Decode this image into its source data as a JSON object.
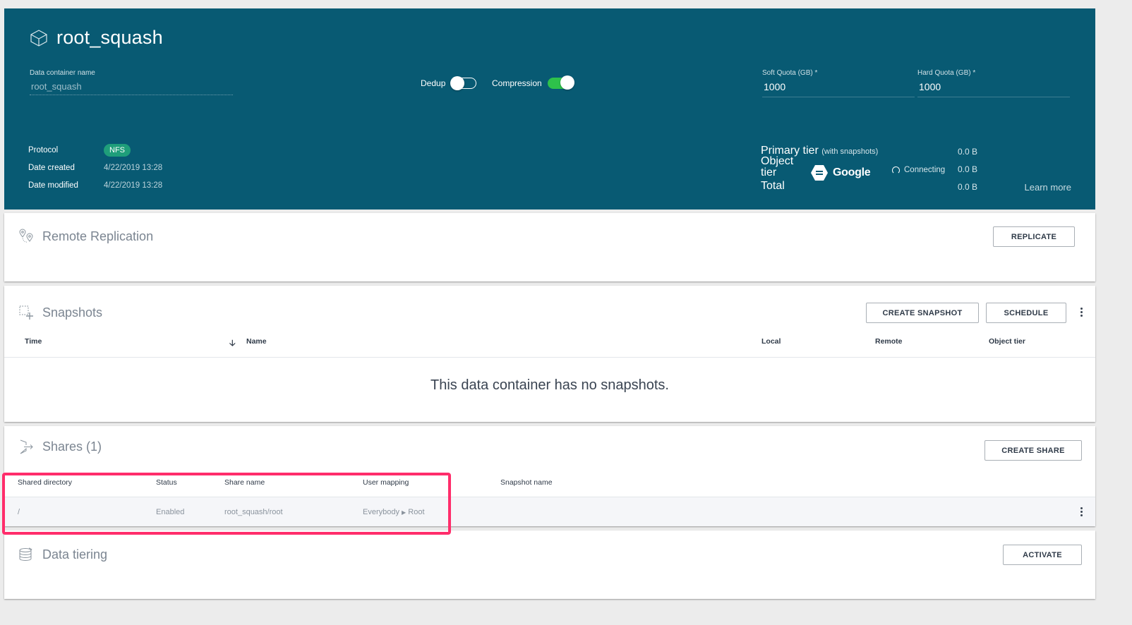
{
  "header": {
    "title": "root_squash",
    "name_field": {
      "label": "Data container name",
      "value": "root_squash"
    },
    "toggles": [
      {
        "label": "Dedup",
        "state": "off"
      },
      {
        "label": "Compression",
        "state": "on"
      }
    ],
    "soft_quota": {
      "label": "Soft Quota (GB) *",
      "value": "1000"
    },
    "hard_quota": {
      "label": "Hard Quota (GB) *",
      "value": "1000"
    },
    "meta": {
      "protocol_label": "Protocol",
      "protocol_value": "NFS",
      "created_label": "Date created",
      "created_value": "4/22/2019 13:28",
      "modified_label": "Date modified",
      "modified_value": "4/22/2019 13:28"
    },
    "tiers": {
      "primary_label": "Primary tier",
      "primary_note": "(with snapshots)",
      "primary_value": "0.0 B",
      "object_label_1": "Object",
      "object_label_2": "tier",
      "object_provider": "Google",
      "object_status": "Connecting",
      "object_value": "0.0 B",
      "total_label": "Total",
      "total_value": "0.0 B",
      "learn_more": "Learn more"
    },
    "colors": {
      "header_bg": "#085a73",
      "toggle_on": "#2ec24b",
      "badge": "#1f9e7a",
      "highlight": "#ff2d6b"
    }
  },
  "replication": {
    "title": "Remote Replication",
    "button": "REPLICATE"
  },
  "snapshots": {
    "title": "Snapshots",
    "create_button": "CREATE SNAPSHOT",
    "schedule_button": "SCHEDULE",
    "columns": [
      "Time",
      "Name",
      "Local",
      "Remote",
      "Object tier"
    ],
    "empty_message": "This data container has no snapshots."
  },
  "shares": {
    "title": "Shares (1)",
    "create_button": "CREATE SHARE",
    "columns": [
      "Shared directory",
      "Status",
      "Share name",
      "User mapping",
      "Snapshot name"
    ],
    "rows": [
      {
        "directory": "/",
        "status": "Enabled",
        "share_name": "root_squash/root",
        "mapping_from": "Everybody",
        "mapping_to": "Root",
        "snapshot_name": ""
      }
    ]
  },
  "tiering": {
    "title": "Data tiering",
    "button": "ACTIVATE"
  }
}
